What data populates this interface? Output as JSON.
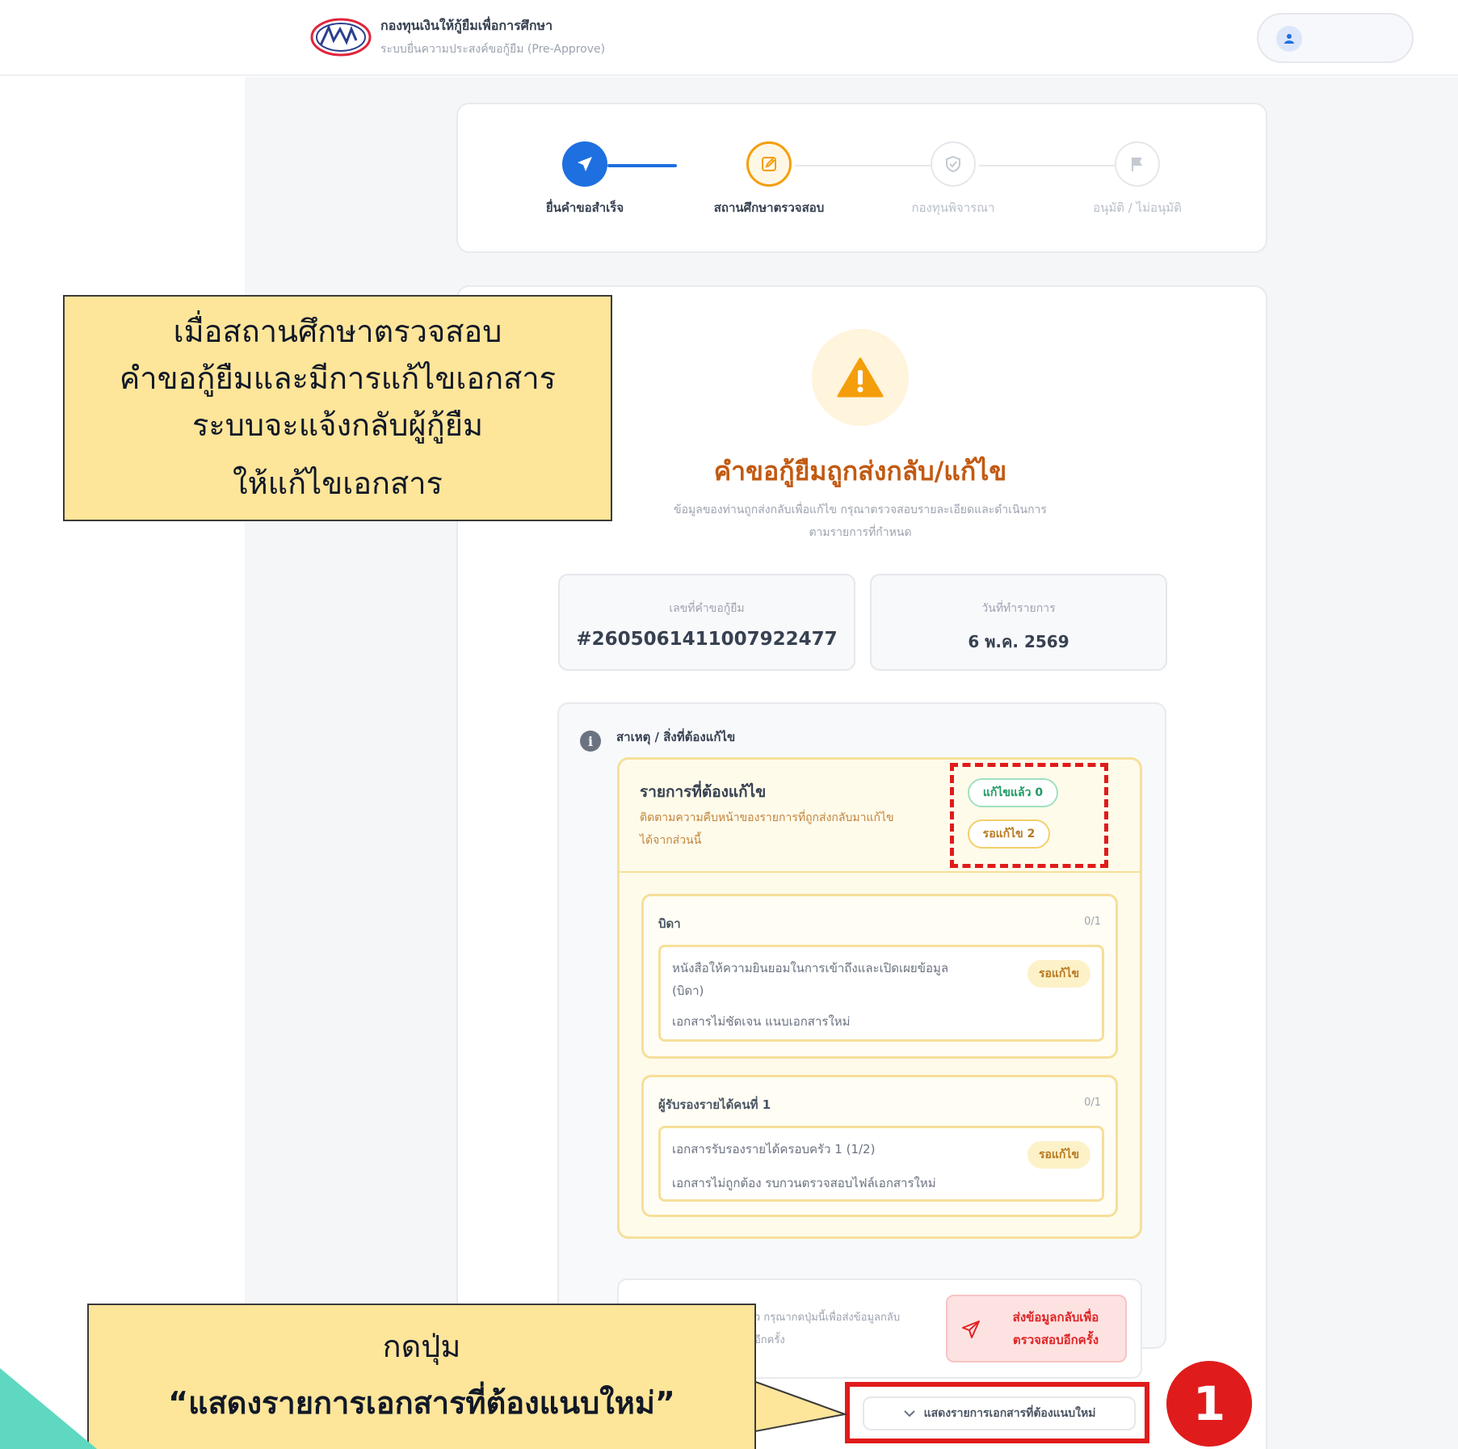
{
  "header": {
    "org_title": "กองทุนเงินให้กู้ยืมเพื่อการศึกษา",
    "org_subtitle": "ระบบยื่นความประสงค์ขอกู้ยืม (Pre-Approve)",
    "logo_text": "กยศ"
  },
  "stepper": {
    "steps": [
      {
        "label": "ยื่นคำขอสำเร็จ",
        "state": "done",
        "icon": "send-icon"
      },
      {
        "label": "สถานศึกษาตรวจสอบ",
        "state": "current",
        "icon": "edit-icon"
      },
      {
        "label": "กองทุนพิจารณา",
        "state": "pending",
        "icon": "shield-icon"
      },
      {
        "label": "อนุมัติ / ไม่อนุมัติ",
        "state": "pending",
        "icon": "flag-icon"
      }
    ]
  },
  "status": {
    "title": "คำขอกู้ยืมถูกส่งกลับ/แก้ไข",
    "desc_line1": "ข้อมูลของท่านถูกส่งกลับเพื่อแก้ไข กรุณาตรวจสอบรายละเอียดและดำเนินการ",
    "desc_line2": "ตามรายการที่กำหนด"
  },
  "info": {
    "request_no_label": "เลขที่คำขอกู้ยืม",
    "request_no": "#2605061411007922477",
    "date_label": "วันที่ทำรายการ",
    "date": "6 พ.ค. 2569"
  },
  "reason": {
    "title": "สาเหตุ / สิ่งที่ต้องแก้ไข",
    "panel_title": "รายการที่ต้องแก้ไข",
    "panel_desc_line1": "ติดตามความคืบหน้าของรายการที่ถูกส่งกลับมาแก้ไข",
    "panel_desc_line2": "ได้จากส่วนนี้",
    "fixed_pill": "แก้ไขแล้ว 0",
    "waiting_pill": "รอแก้ไข 2"
  },
  "sections": [
    {
      "title": "บิดา",
      "count": "0/1",
      "doc_name_line1": "หนังสือให้ความยินยอมในการเข้าถึงและเปิดเผยข้อมูล",
      "doc_name_line2": "(บิดา)",
      "note": "เอกสารไม่ชัดเจน แนบเอกสารใหม่",
      "badge": "รอแก้ไข"
    },
    {
      "title": "ผู้รับรองรายได้คนที่ 1",
      "count": "0/1",
      "doc_name_line1": "เอกสารรับรองรายได้ครอบครัว 1 (1/2)",
      "note": "เอกสารไม่ถูกต้อง รบกวนตรวจสอบไฟล์เอกสารใหม่",
      "badge": "รอแก้ไข"
    }
  ],
  "resend": {
    "desc_line1": "ว กรุณากดปุ่มนี้เพื่อส่งข้อมูลกลับ",
    "desc_line2": "อีกครั้ง",
    "button_line1": "ส่งข้อมูลกลับเพื่อ",
    "button_line2": "ตรวจสอบอีกครั้ง"
  },
  "show_docs_button": "แสดงรายการเอกสารที่ต้องแนบใหม่",
  "step_marker": "1",
  "callout_top": {
    "line1": "เมื่อสถานศึกษาตรวจสอบ",
    "line2": "คำขอกู้ยืมและมีการแก้ไขเอกสาร",
    "line3": "ระบบจะแจ้งกลับผู้กู้ยืม",
    "line4": "ให้แก้ไขเอกสาร"
  },
  "callout_bottom": {
    "line1": "กดปุ่ม",
    "line2": "“แสดงรายการเอกสารที่ต้องแนบใหม่”"
  },
  "colors": {
    "primary": "#1e6fe0",
    "warning": "#f59e0b",
    "status_title": "#c25a12",
    "highlight_red": "#e01b1b",
    "callout_fill": "#fde59a"
  }
}
